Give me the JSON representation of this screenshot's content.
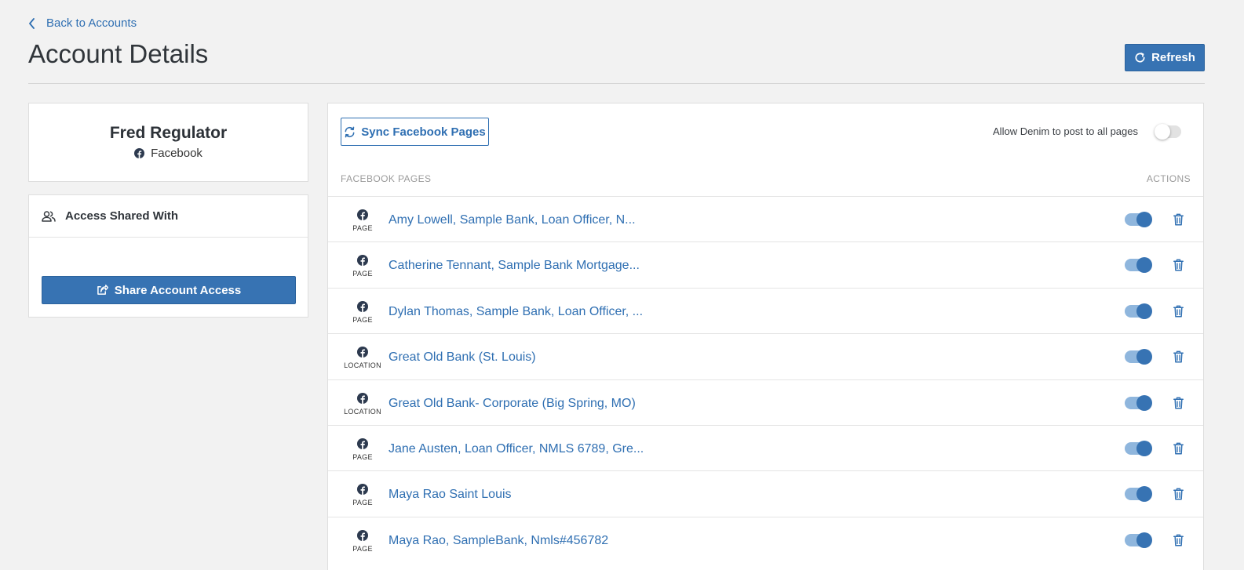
{
  "nav": {
    "back_label": "Back to Accounts"
  },
  "header": {
    "title": "Account Details",
    "refresh_label": "Refresh"
  },
  "profile": {
    "name": "Fred Regulator",
    "platform": "Facebook",
    "platform_icon": "facebook-icon"
  },
  "access": {
    "heading": "Access Shared With",
    "share_label": "Share Account Access"
  },
  "pages_panel": {
    "sync_label": "Sync Facebook Pages",
    "allow_all_label": "Allow Denim to post to all pages",
    "allow_all_enabled": false,
    "col_pages": "FACEBOOK PAGES",
    "col_actions": "ACTIONS",
    "rows": [
      {
        "type": "PAGE",
        "name": "Amy Lowell, Sample Bank, Loan Officer, N...",
        "enabled": true
      },
      {
        "type": "PAGE",
        "name": "Catherine Tennant, Sample Bank Mortgage...",
        "enabled": true
      },
      {
        "type": "PAGE",
        "name": "Dylan Thomas, Sample Bank, Loan Officer, ...",
        "enabled": true
      },
      {
        "type": "LOCATION",
        "name": "Great Old Bank (St. Louis)",
        "enabled": true
      },
      {
        "type": "LOCATION",
        "name": "Great Old Bank- Corporate (Big Spring, MO)",
        "enabled": true
      },
      {
        "type": "PAGE",
        "name": "Jane Austen, Loan Officer, NMLS 6789, Gre...",
        "enabled": true
      },
      {
        "type": "PAGE",
        "name": "Maya Rao Saint Louis",
        "enabled": true
      },
      {
        "type": "PAGE",
        "name": "Maya Rao, SampleBank, Nmls#456782",
        "enabled": true
      }
    ]
  },
  "colors": {
    "accent": "#3773b3",
    "link": "#2f6fb2",
    "background": "#f2f2f2",
    "facebook_icon": "#2d3a4f"
  }
}
